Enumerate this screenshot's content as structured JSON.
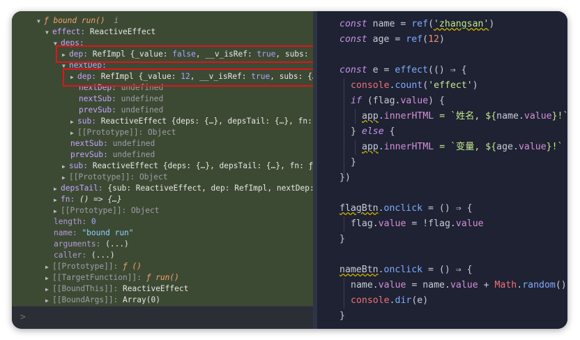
{
  "tree": {
    "bound_run_label": "ƒ bound run()",
    "info_icon": "i",
    "effect_key": "effect:",
    "effect_value": "ReactiveEffect",
    "deps_key": "deps:",
    "dep1_key": "dep:",
    "dep1_value_a": "RefImpl {_value: ",
    "dep1_value_b": "false",
    "dep1_value_c": ", __v_isRef: ",
    "dep1_value_d": "true",
    "dep1_value_e": ", subs: {",
    "nextdep_key": "nextDep:",
    "dep2_key": "dep:",
    "dep2_value_a": "RefImpl {_value: ",
    "dep2_value_b": "12",
    "dep2_value_c": ", __v_isRef: ",
    "dep2_value_d": "true",
    "dep2_value_e": ", subs: {…",
    "inner_nextdep_key": "nextDep:",
    "inner_nextdep_val": "undefined",
    "inner_nextsub_key": "nextSub:",
    "inner_nextsub_val": "undefined",
    "inner_prevsub_key": "prevSub:",
    "inner_prevsub_val": "undefined",
    "inner_sub_key": "sub:",
    "inner_sub_val": "ReactiveEffect {deps: {…}, depsTail: {…}, fn:",
    "inner_proto": "[[Prototype]]: Object",
    "nextsub_key": "nextSub:",
    "nextsub_val": "undefined",
    "prevsub_key": "prevSub:",
    "prevsub_val": "undefined",
    "sub_key": "sub:",
    "sub_val": "ReactiveEffect {deps: {…}, depsTail: {…}, fn: ƒ",
    "proto1": "[[Prototype]]: Object",
    "depstail_key": "depsTail:",
    "depstail_val": "{sub: ReactiveEffect, dep: RefImpl, nextDep:",
    "fn_key": "fn:",
    "fn_val": "() => {…}",
    "proto2": "[[Prototype]]: Object",
    "length_key": "length:",
    "length_val": "0",
    "name_key": "name:",
    "name_val": "\"bound run\"",
    "arguments_key": "arguments:",
    "arguments_val": "(...)",
    "caller_key": "caller:",
    "caller_val": "(...)",
    "proto_fn_key": "[[Prototype]]:",
    "proto_fn_val": "ƒ ()",
    "target_key": "[[TargetFunction]]:",
    "target_val": "ƒ run()",
    "boundthis_key": "[[BoundThis]]:",
    "boundthis_val": "ReactiveEffect",
    "boundargs_key": "[[BoundArgs]]:",
    "boundargs_val": "Array(0)"
  },
  "console": {
    "prompt": ">"
  },
  "code": {
    "l1_kw": "const",
    "l1_name": " name = ",
    "l1_fn": "ref",
    "l1_str": "'zhangsan'",
    "l1_end": ")",
    "l2_kw": "const",
    "l2_name": " age = ",
    "l2_fn": "ref",
    "l2_num": "12",
    "l2_end": ")",
    "l3_kw": "const",
    "l3_rest": " e = ",
    "l3_fn": "effect",
    "l3_tail": "(() ⇒ {",
    "l4_obj": "console",
    "l4_fn": "count",
    "l4_str": "'effect'",
    "l5_kw": "if",
    "l5_a": " (flag.",
    "l5_prop": "value",
    "l5_b": ") {",
    "l6_app": "app",
    "l6_prop": "innerHTML",
    "l6_str_a": " = `姓名, ${",
    "l6_var": "name",
    "l6_prop2": "value",
    "l6_str_b": "}!`",
    "l7_a": "} ",
    "l7_kw": "else",
    "l7_b": " {",
    "l8_app": "app",
    "l8_prop": "innerHTML",
    "l8_str_a": " = `变量, ${",
    "l8_var": "age",
    "l8_prop2": "value",
    "l8_str_b": "}!`",
    "l9": "}",
    "l10": "})",
    "l11_var": "flagBtn",
    "l11_prop": "onclick",
    "l11_rest": " = () ⇒ {",
    "l12_a": "flag.",
    "l12_prop": "value",
    "l12_b": " = !flag.",
    "l12_prop2": "value",
    "l13": "}",
    "l14_var": "nameBtn",
    "l14_prop": "onclick",
    "l14_rest": " = () ⇒ {",
    "l15_a": "name.",
    "l15_prop": "value",
    "l15_b": " = name.",
    "l15_prop2": "value",
    "l15_c": " + ",
    "l15_obj": "Math",
    "l15_fn": "random",
    "l15_d": "()",
    "l16_obj": "console",
    "l16_fn": "dir",
    "l16_b": "(e)",
    "l17": "}"
  },
  "colors": {
    "devtools_bg": "#3d4a33",
    "editor_bg": "#1e2232",
    "highlight_border": "#e0141b"
  }
}
